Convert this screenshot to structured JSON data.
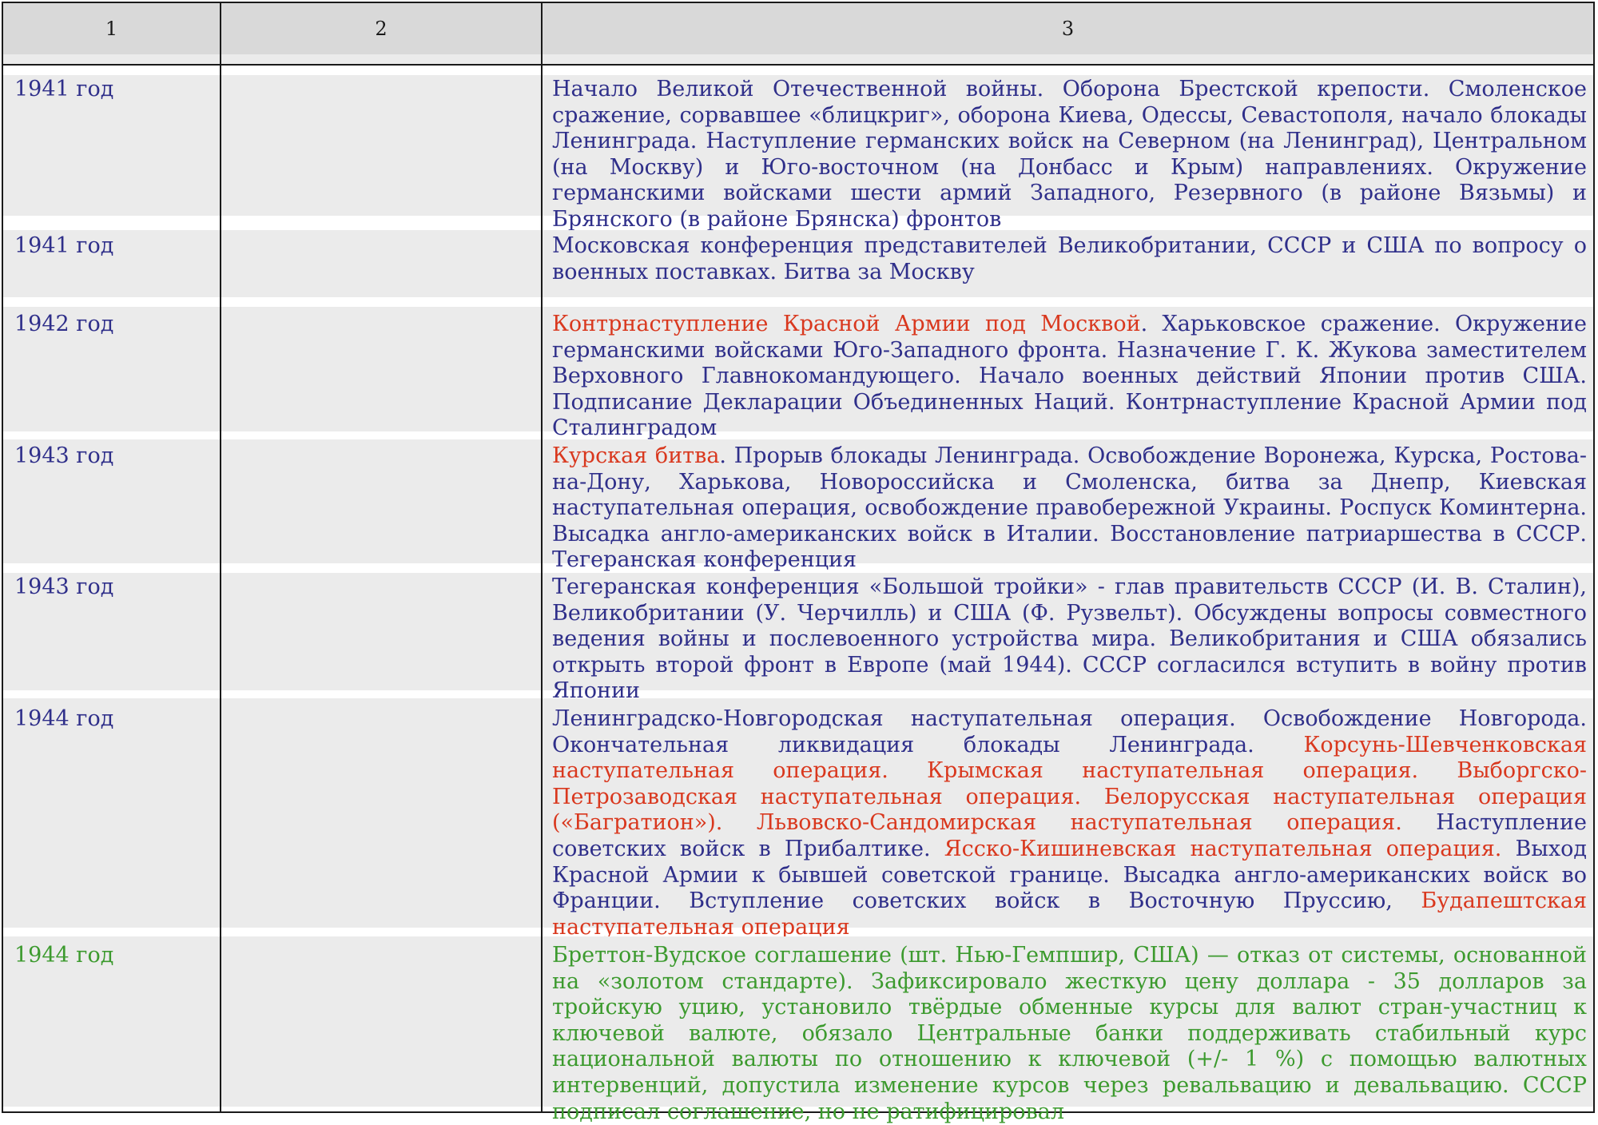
{
  "header": {
    "col1": "1",
    "col2": "2",
    "col3": "3"
  },
  "colors": {
    "navy": "#2f2f8a",
    "red": "#d9381e",
    "green": "#3c9a2e",
    "band": "#ebebeb",
    "header": "#d9d9d9"
  },
  "rows": [
    {
      "year": "1941 год",
      "seg": [
        "Начало Великой Отечественной войны. Оборона Брестской крепости. Смоленское сражение, сорвавшее «блицкриг», оборона Киева, Одессы, Севастополя, начало блокады Ленинграда. Наступление германских войск на Северном (на Ленинград), Центральном (на Москву) и Юго-восточном (на Донбасс и Крым) направлениях. Окружение германскими войсками шести армий Западного, Резервного (в районе Вязьмы) и Брянского (в районе Брянска) фронтов"
      ]
    },
    {
      "year": "1941 год",
      "seg": [
        "Московская конференция представителей Великобритании, СССР и США по вопросу о военных поставках. Битва за Москву"
      ]
    },
    {
      "year": "1942 год",
      "seg": [
        "Контрнаступление Красной Армии под Москвой",
        ". Харьковское сражение. Окружение германскими войсками Юго-Западного фронта. Назначение Г. К. Жукова заместителем Верховного Главнокомандующего. Начало военных действий Японии против США. Подписание Декларации Объединенных Наций. Контрнаступление Красной Армии под Сталинградом"
      ]
    },
    {
      "year": "1943 год",
      "seg": [
        "Курская битва",
        ". Прорыв блокады Ленинграда. Освобождение Воронежа, Курска, Ростова-на-Дону, Харькова, Новороссийска и Смоленска, битва за Днепр, Киевская наступательная операция, освобождение правобережной Украины. Роспуск Коминтерна. Высадка англо-американских войск в Италии. Восстановление патриаршества в СССР. Тегеранская конференция"
      ]
    },
    {
      "year": "1943 год",
      "seg": [
        "Тегеранская конференция «Большой тройки» - глав правительств СССР (И. В. Сталин), Великобритании (У. Черчилль) и США (Ф. Рузвельт). Обсуждены вопросы совместного ведения войны и послевоенного устройства мира. Великобритания и США обязались открыть второй фронт в Европе (май 1944). СССР согласился вступить в войну против Японии"
      ]
    },
    {
      "year": "1944 год",
      "seg": [
        "Ленинградско-Новгородская наступательная операция. Освобождение Новгорода. Окончательная ликвидация блокады Ленинграда. ",
        "Корсунь-Шевченковская наступательная операция. Крымская наступательная операция. Выборгско-Петрозаводская наступательная операция. Белорусская наступательная операция («Багратион»). Львовско-Сандомирская наступательная операция.",
        " Наступление советских войск в Прибалтике. ",
        "Ясско-Кишиневская наступательная операция.",
        " Выход Красной Армии к бывшей советской границе. Высадка англо-американских войск во Франции. Вступление советских войск в Восточную Пруссию, ",
        "Будапештская наступательная операция"
      ]
    },
    {
      "year": "1944 год",
      "seg": [
        "Бреттон-Вудское соглашение (шт. Нью-Гемпшир, США) — отказ от системы, основанной на «золотом стандарте). Зафиксировало жесткую цену доллара - 35 долларов за тройскую уцию, установило твёрдые обменные курсы для валют стран-участниц к ключевой валюте, обязало Центральные банки поддерживать стабильный курс национальной валюты по отношению к ключевой (+/- 1 %) с помощью валютных интервенций, допустила изменение курсов через ревальвацию и девальвацию. СССР подписал соглашение, но не ратифицировал"
      ]
    }
  ]
}
